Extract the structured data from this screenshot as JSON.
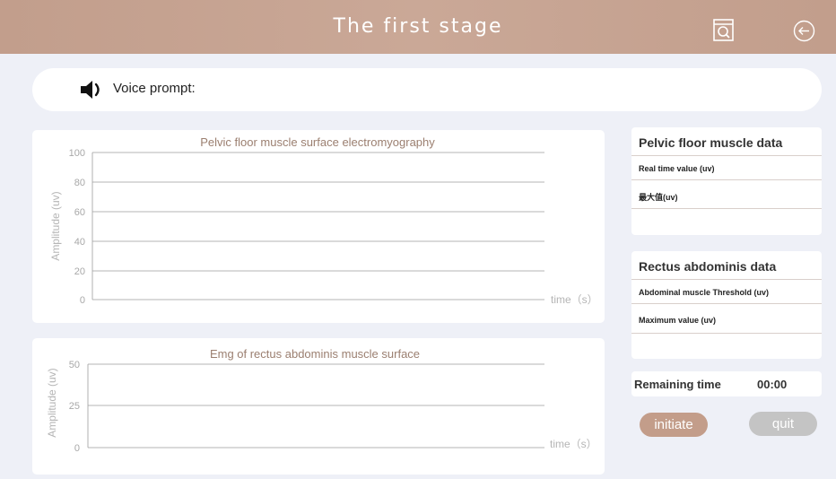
{
  "header": {
    "title": "The first stage",
    "report_icon": "report-search-icon",
    "back_icon": "back-arrow-icon"
  },
  "voice": {
    "label": "Voice prompt:",
    "icon": "speaker-icon"
  },
  "colors": {
    "header_bg": "#c29e8c",
    "accent": "#c39d8a",
    "quit_bg": "#c4c4c4",
    "page_bg": "#eef0f7"
  },
  "chart_data": [
    {
      "type": "line",
      "title": "Pelvic floor muscle surface electromyography",
      "ylabel": "Amplitude (uv)",
      "xlabel": "time（s）",
      "ylim": [
        0,
        100
      ],
      "yticks": [
        0,
        20,
        40,
        60,
        80,
        100
      ],
      "grid": true,
      "series": []
    },
    {
      "type": "line",
      "title": "Emg of rectus abdominis muscle surface",
      "ylabel": "Amplitude (uv)",
      "xlabel": "time（s）",
      "ylim": [
        0,
        50
      ],
      "yticks": [
        0,
        25,
        50
      ],
      "grid": true,
      "series": []
    }
  ],
  "pelvic_card": {
    "title": "Pelvic floor muscle data",
    "row1": "Real time value (uv)",
    "row2": "最大值(uv)"
  },
  "rectus_card": {
    "title": "Rectus abdominis data",
    "row1": "Abdominal muscle Threshold (uv)",
    "row2": "Maximum value (uv)"
  },
  "remaining": {
    "label": "Remaining time",
    "value": "00:00"
  },
  "buttons": {
    "initiate": "initiate",
    "quit": "quit"
  }
}
